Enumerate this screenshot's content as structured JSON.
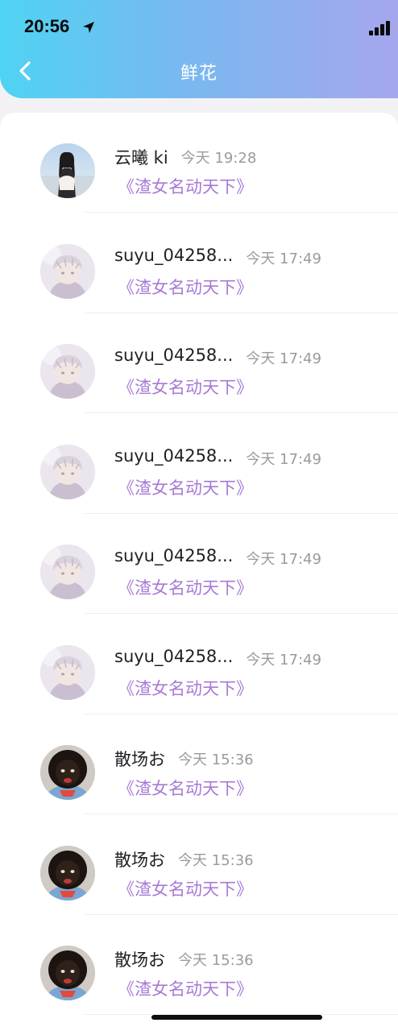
{
  "status_bar": {
    "time": "20:56"
  },
  "header": {
    "title": "鲜花",
    "gradient": [
      "#4fd3f3",
      "#a6a6ee"
    ]
  },
  "colors": {
    "gift_text": "#a77ad6",
    "time_text": "#9a9aa0"
  },
  "list": [
    {
      "name": "云曦 ki",
      "time": "今天 19:28",
      "gift": "《渣女名动天下》",
      "avatar": "avatar-woman"
    },
    {
      "name": "suyu_04258...",
      "time": "今天 17:49",
      "gift": "《渣女名动天下》",
      "avatar": "avatar-anime-boy"
    },
    {
      "name": "suyu_04258...",
      "time": "今天 17:49",
      "gift": "《渣女名动天下》",
      "avatar": "avatar-anime-boy"
    },
    {
      "name": "suyu_04258...",
      "time": "今天 17:49",
      "gift": "《渣女名动天下》",
      "avatar": "avatar-anime-boy"
    },
    {
      "name": "suyu_04258...",
      "time": "今天 17:49",
      "gift": "《渣女名动天下》",
      "avatar": "avatar-anime-boy"
    },
    {
      "name": "suyu_04258...",
      "time": "今天 17:49",
      "gift": "《渣女名动天下》",
      "avatar": "avatar-anime-boy"
    },
    {
      "name": "散场お",
      "time": "今天 15:36",
      "gift": "《渣女名动天下》",
      "avatar": "avatar-child"
    },
    {
      "name": "散场お",
      "time": "今天 15:36",
      "gift": "《渣女名动天下》",
      "avatar": "avatar-child"
    },
    {
      "name": "散场お",
      "time": "今天 15:36",
      "gift": "《渣女名动天下》",
      "avatar": "avatar-child"
    }
  ]
}
